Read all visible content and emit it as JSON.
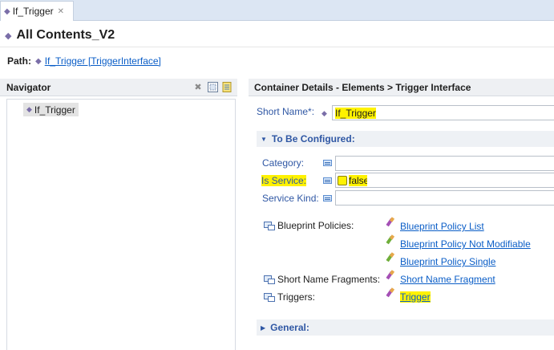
{
  "tab": {
    "label": "If_Trigger",
    "close": "✕"
  },
  "editor": {
    "title": "All Contents_V2"
  },
  "path": {
    "label": "Path:",
    "value": "If_Trigger [TriggerInterface]"
  },
  "navigator": {
    "title": "Navigator",
    "tree": [
      {
        "label": "If_Trigger"
      }
    ]
  },
  "details": {
    "title": "Container Details - Elements > Trigger Interface",
    "short_name": {
      "label": "Short Name*:",
      "value": "If_Trigger"
    },
    "to_be_configured": {
      "title": "To Be Configured:",
      "category": {
        "label": "Category:",
        "value": ""
      },
      "is_service": {
        "label": "Is Service:",
        "value": "false"
      },
      "service_kind": {
        "label": "Service Kind:",
        "value": ""
      }
    },
    "blueprint_policies": {
      "label": "Blueprint Policies:",
      "items": [
        "Blueprint Policy List",
        "Blueprint Policy Not Modifiable",
        "Blueprint Policy Single"
      ]
    },
    "short_name_fragments": {
      "label": "Short Name Fragments:",
      "items": [
        "Short Name Fragment"
      ]
    },
    "triggers": {
      "label": "Triggers:",
      "items": [
        "Trigger"
      ]
    },
    "general": {
      "title": "General:"
    }
  },
  "colors": {
    "accent": "#2f57a4",
    "link": "#0b5ec7",
    "highlight": "#fff200",
    "header_bg": "#eef0f3"
  }
}
